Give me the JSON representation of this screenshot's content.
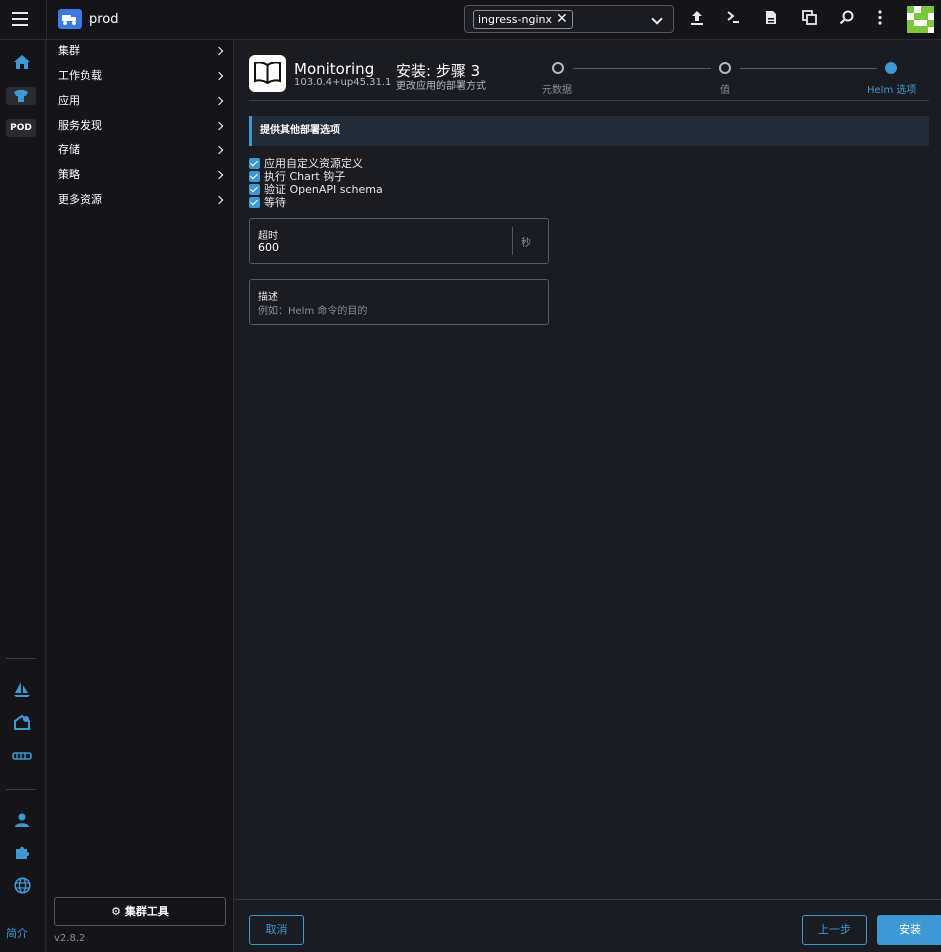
{
  "header": {
    "cluster_name": "prod",
    "namespace_chip": "ingress-nginx",
    "namespace_remove": "✕"
  },
  "rail": {
    "pod_badge": "POD",
    "about_label": "简介"
  },
  "sidenav": {
    "items": [
      {
        "label": "集群"
      },
      {
        "label": "工作负载"
      },
      {
        "label": "应用"
      },
      {
        "label": "服务发现"
      },
      {
        "label": "存储"
      },
      {
        "label": "策略"
      },
      {
        "label": "更多资源"
      }
    ],
    "cluster_tools_label": "集群工具",
    "version": "v2.8.2"
  },
  "app": {
    "name": "Monitoring",
    "version": "103.0.4+up45.31.1"
  },
  "wizard": {
    "title": "安装: 步骤 3",
    "subtitle": "更改应用的部署方式",
    "steps": [
      {
        "label": "元数据",
        "active": false
      },
      {
        "label": "值",
        "active": false
      },
      {
        "label": "Helm 选项",
        "active": true
      }
    ]
  },
  "form": {
    "banner": "提供其他部署选项",
    "checkboxes": [
      {
        "label": "应用自定义资源定义",
        "checked": true
      },
      {
        "label": "执行 Chart 钩子",
        "checked": true
      },
      {
        "label": "验证 OpenAPI schema",
        "checked": true
      },
      {
        "label": "等待",
        "checked": true
      }
    ],
    "timeout": {
      "label": "超时",
      "value": "600",
      "suffix": "秒"
    },
    "description": {
      "label": "描述",
      "placeholder": "例如：Helm 命令的目的"
    }
  },
  "footer": {
    "cancel_label": "取消",
    "prev_label": "上一步",
    "install_label": "安装"
  },
  "colors": {
    "accent": "#3d98d3",
    "background": "#1b1c21",
    "panel": "#141419"
  }
}
